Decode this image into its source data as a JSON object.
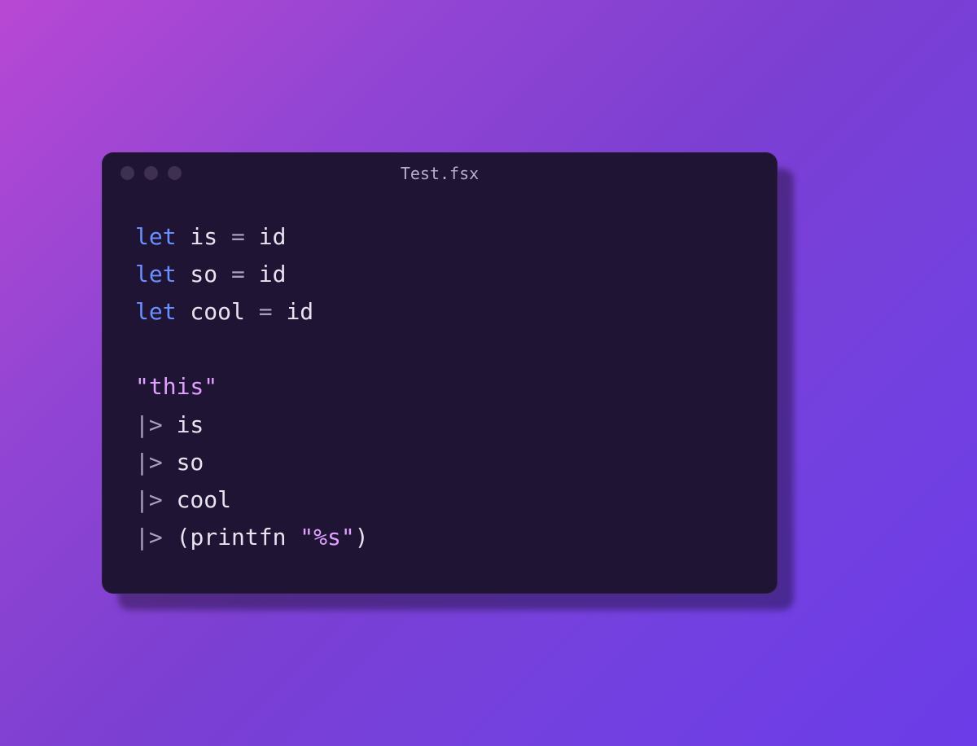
{
  "window": {
    "title": "Test.fsx"
  },
  "code": {
    "lines": [
      {
        "tokens": [
          {
            "t": "kw",
            "v": "let"
          },
          {
            "t": "ident",
            "v": " is "
          },
          {
            "t": "op",
            "v": "="
          },
          {
            "t": "ident",
            "v": " id"
          }
        ]
      },
      {
        "tokens": [
          {
            "t": "kw",
            "v": "let"
          },
          {
            "t": "ident",
            "v": " so "
          },
          {
            "t": "op",
            "v": "="
          },
          {
            "t": "ident",
            "v": " id"
          }
        ]
      },
      {
        "tokens": [
          {
            "t": "kw",
            "v": "let"
          },
          {
            "t": "ident",
            "v": " cool "
          },
          {
            "t": "op",
            "v": "="
          },
          {
            "t": "ident",
            "v": " id"
          }
        ]
      },
      {
        "tokens": []
      },
      {
        "tokens": [
          {
            "t": "str",
            "v": "\"this\""
          }
        ]
      },
      {
        "tokens": [
          {
            "t": "op",
            "v": "|>"
          },
          {
            "t": "ident",
            "v": " is"
          }
        ]
      },
      {
        "tokens": [
          {
            "t": "op",
            "v": "|>"
          },
          {
            "t": "ident",
            "v": " so"
          }
        ]
      },
      {
        "tokens": [
          {
            "t": "op",
            "v": "|>"
          },
          {
            "t": "ident",
            "v": " cool"
          }
        ]
      },
      {
        "tokens": [
          {
            "t": "op",
            "v": "|>"
          },
          {
            "t": "ident",
            "v": " ("
          },
          {
            "t": "ident",
            "v": "printfn "
          },
          {
            "t": "str",
            "v": "\"%s\""
          },
          {
            "t": "ident",
            "v": ")"
          }
        ]
      }
    ]
  }
}
